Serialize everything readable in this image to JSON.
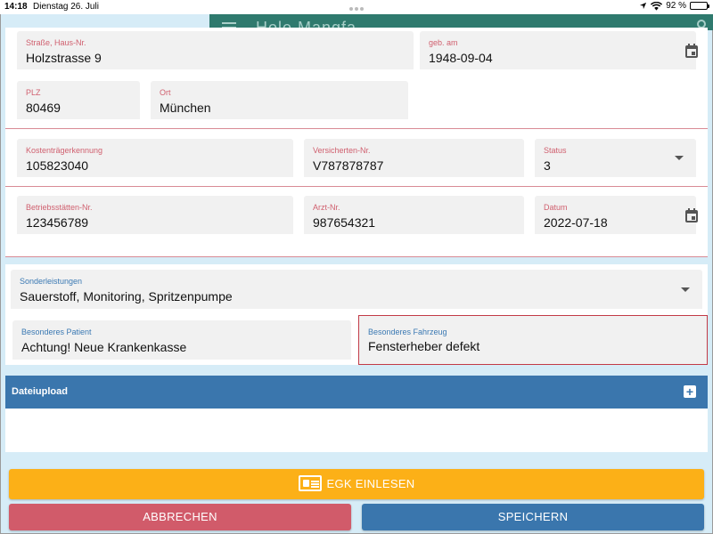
{
  "status_bar": {
    "time": "14:18",
    "date": "Dienstag 26. Juli",
    "battery": "92 %"
  },
  "app_bar": {
    "title": "Hole Mangfa..."
  },
  "address": {
    "street": {
      "label": "Straße, Haus-Nr.",
      "value": "Holzstrasse 9"
    },
    "birthdate": {
      "label": "geb. am",
      "value": "1948-09-04"
    },
    "zip": {
      "label": "PLZ",
      "value": "80469"
    },
    "city": {
      "label": "Ort",
      "value": "München"
    }
  },
  "insurance": {
    "payer_id": {
      "label": "Kostenträgerkennung",
      "value": "105823040"
    },
    "insured_no": {
      "label": "Versicherten-Nr.",
      "value": "V787878787"
    },
    "status": {
      "label": "Status",
      "value": "3"
    }
  },
  "practice": {
    "site_no": {
      "label": "Betriebsstätten-Nr.",
      "value": "123456789"
    },
    "doctor_no": {
      "label": "Arzt-Nr.",
      "value": "987654321"
    },
    "date": {
      "label": "Datum",
      "value": "2022-07-18"
    }
  },
  "extras": {
    "special_services": {
      "label": "Sonderleistungen",
      "value": "Sauerstoff, Monitoring, Spritzenpumpe"
    },
    "special_patient": {
      "label": "Besonderes Patient",
      "value": "Achtung! Neue Krankenkasse"
    },
    "special_vehicle": {
      "label": "Besonderes Fahrzeug",
      "value": "Fensterheber defekt"
    }
  },
  "upload": {
    "title": "Dateiupload",
    "add_symbol": "+"
  },
  "buttons": {
    "egk": "EGK EINLESEN",
    "cancel": "ABBRECHEN",
    "save": "SPEICHERN"
  },
  "colors": {
    "accent_red": "#d0606f",
    "accent_blue": "#3a76ad",
    "egk_yellow": "#fcb017",
    "header_teal": "#2f7a6e",
    "background": "#d6ecf7"
  }
}
